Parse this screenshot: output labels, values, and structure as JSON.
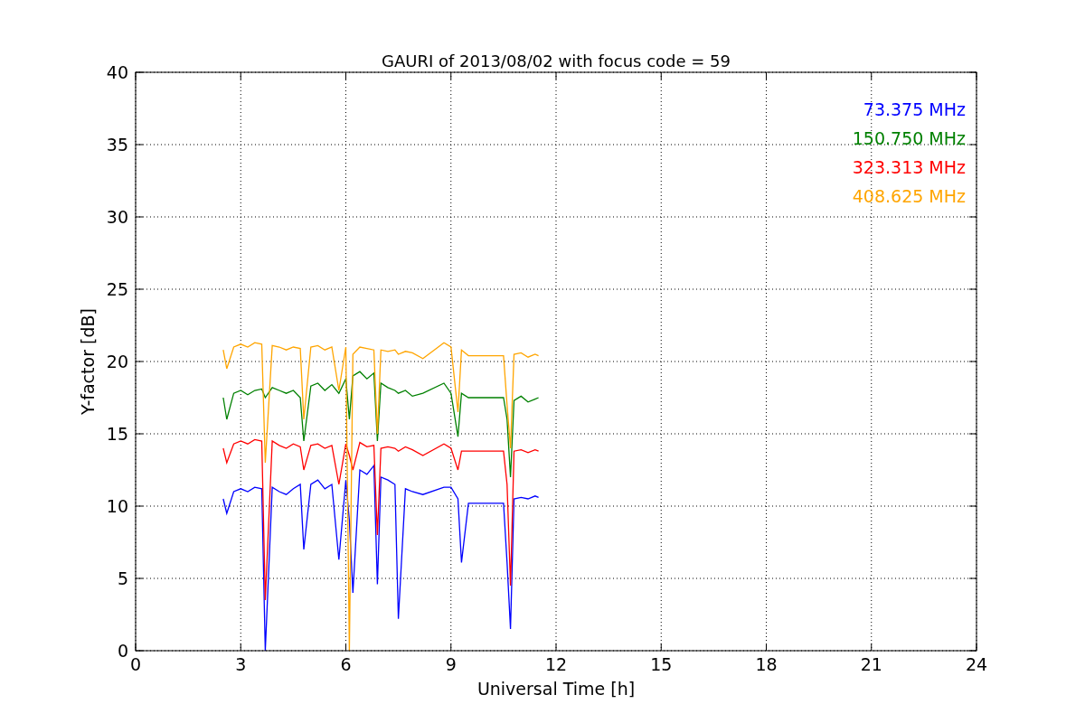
{
  "figure": {
    "chart_data": {
      "type": "line",
      "title": "GAURI of 2013/08/02 with focus code = 59",
      "xlabel": "Universal Time [h]",
      "ylabel": "Y-factor [dB]",
      "grid": true,
      "xlim": [
        0,
        24
      ],
      "ylim": [
        0,
        40
      ],
      "xticks": [
        0,
        3,
        6,
        9,
        12,
        15,
        18,
        21,
        24
      ],
      "yticks": [
        0,
        5,
        10,
        15,
        20,
        25,
        30,
        35,
        40
      ],
      "x": [
        2.5,
        2.6,
        2.8,
        3.0,
        3.2,
        3.4,
        3.6,
        3.7,
        3.9,
        4.1,
        4.3,
        4.5,
        4.7,
        4.8,
        5.0,
        5.2,
        5.4,
        5.6,
        5.8,
        6.0,
        6.1,
        6.2,
        6.4,
        6.6,
        6.8,
        6.9,
        7.0,
        7.2,
        7.4,
        7.5,
        7.7,
        7.9,
        8.2,
        8.8,
        9.0,
        9.2,
        9.3,
        9.5,
        10.5,
        10.6,
        10.7,
        10.8,
        11.0,
        11.2,
        11.4,
        11.5
      ],
      "series": [
        {
          "name": "73.375 MHz",
          "color": "#0000ff",
          "values": [
            10.5,
            9.5,
            11,
            11.2,
            11,
            11.3,
            11.2,
            0,
            11.3,
            11,
            10.8,
            11.2,
            11.5,
            7.0,
            11.5,
            11.8,
            11.2,
            11.5,
            6.3,
            11.8,
            9.0,
            4.0,
            12.5,
            12.2,
            12.8,
            4.6,
            12,
            11.8,
            11.5,
            2.2,
            11.2,
            11.0,
            10.8,
            11.3,
            11.3,
            10.5,
            6.1,
            10.2,
            10.2,
            6.1,
            1.5,
            10.5,
            10.6,
            10.5,
            10.7,
            10.6
          ]
        },
        {
          "name": "150.750 MHz",
          "color": "#008000",
          "values": [
            17.5,
            16,
            17.8,
            18,
            17.7,
            18,
            18.1,
            17.5,
            18.2,
            18,
            17.8,
            18,
            17.5,
            14.5,
            18.3,
            18.5,
            18,
            18.4,
            17.8,
            18.8,
            16,
            19,
            19.3,
            18.8,
            19.2,
            14.5,
            18.5,
            18.2,
            18,
            17.8,
            18,
            17.6,
            17.8,
            18.5,
            17.8,
            14.8,
            17.8,
            17.5,
            17.5,
            16,
            12,
            17.3,
            17.6,
            17.2,
            17.4,
            17.5
          ]
        },
        {
          "name": "323.313 MHz",
          "color": "#ff0000",
          "values": [
            14,
            13,
            14.3,
            14.5,
            14.3,
            14.6,
            14.5,
            3.5,
            14.5,
            14.2,
            14,
            14.3,
            14.1,
            12.5,
            14.2,
            14.3,
            14,
            14.2,
            11.5,
            14.3,
            13.5,
            12.5,
            14.4,
            14.1,
            14.2,
            8.0,
            14,
            14.1,
            14,
            13.8,
            14.1,
            13.9,
            13.5,
            14.3,
            14,
            12.5,
            13.8,
            13.8,
            13.8,
            11.5,
            4.5,
            13.8,
            13.9,
            13.7,
            13.9,
            13.8
          ]
        },
        {
          "name": "408.625 MHz",
          "color": "#ffa500",
          "values": [
            20.8,
            19.5,
            21,
            21.2,
            21,
            21.3,
            21.2,
            13,
            21.1,
            21,
            20.8,
            21,
            20.9,
            16,
            21,
            21.1,
            20.8,
            21,
            18,
            21,
            0,
            20.5,
            21,
            20.9,
            20.8,
            15,
            20.8,
            20.7,
            20.8,
            20.5,
            20.7,
            20.6,
            20.2,
            21.3,
            21,
            16.5,
            20.8,
            20.4,
            20.4,
            17,
            14,
            20.5,
            20.6,
            20.3,
            20.5,
            20.4
          ]
        }
      ]
    }
  }
}
